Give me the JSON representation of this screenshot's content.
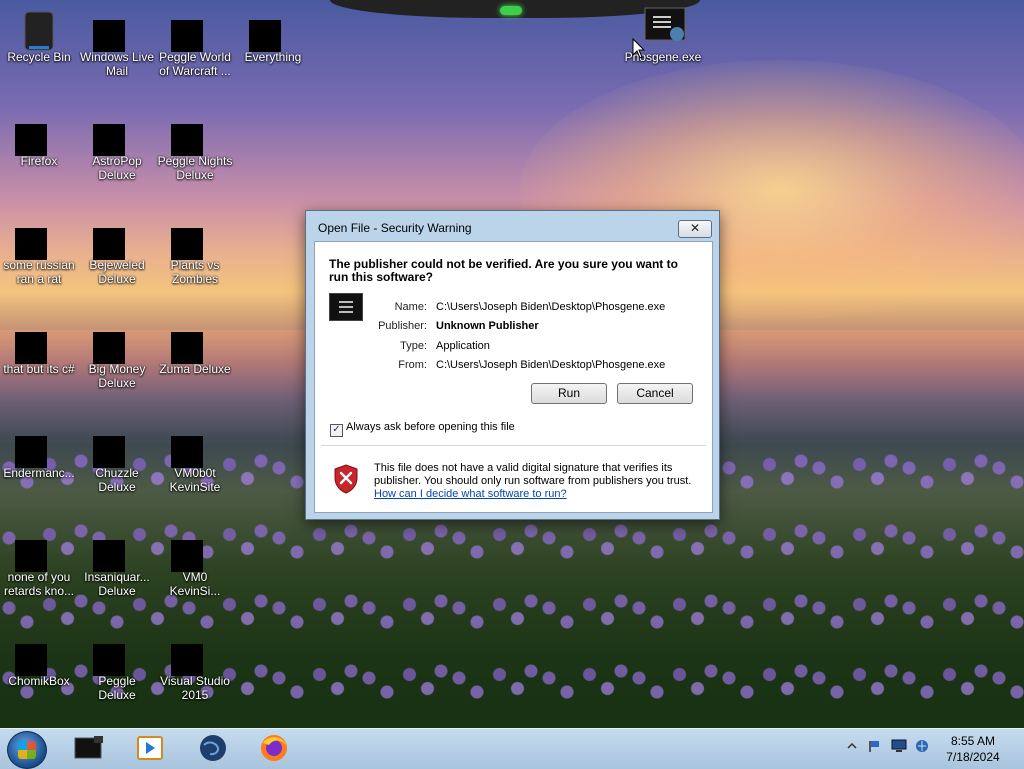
{
  "desktop_icons": [
    {
      "label": "Recycle Bin"
    },
    {
      "label": "Windows Live Mail"
    },
    {
      "label": "Peggle World of Warcraft ..."
    },
    {
      "label": "Everything"
    },
    {
      "label": "Phosgene.exe"
    },
    {
      "label": "Firefox"
    },
    {
      "label": "AstroPop Deluxe"
    },
    {
      "label": "Peggle Nights Deluxe"
    },
    {
      "label": "some russian ran a rat"
    },
    {
      "label": "Bejeweled Deluxe"
    },
    {
      "label": "Plants vs Zombies"
    },
    {
      "label": "that but its c#"
    },
    {
      "label": "Big Money Deluxe"
    },
    {
      "label": "Zuma Deluxe"
    },
    {
      "label": "Endermanc..."
    },
    {
      "label": "Chuzzle Deluxe"
    },
    {
      "label": "VM0b0t KevinSite"
    },
    {
      "label": "none of you retards kno..."
    },
    {
      "label": "Insaniquar... Deluxe"
    },
    {
      "label": "VM0 KevinSi..."
    },
    {
      "label": "ChomikBox"
    },
    {
      "label": "Peggle Deluxe"
    },
    {
      "label": "Visual Studio 2015"
    }
  ],
  "dialog": {
    "title": "Open File - Security Warning",
    "close_label": "✕",
    "heading": "The publisher could not be verified.  Are you sure you want to run this software?",
    "fields": [
      {
        "key": "Name:",
        "value": "C:\\Users\\Joseph Biden\\Desktop\\Phosgene.exe"
      },
      {
        "key": "Publisher:",
        "value": "Unknown Publisher"
      },
      {
        "key": "Type:",
        "value": "Application"
      },
      {
        "key": "From:",
        "value": "C:\\Users\\Joseph Biden\\Desktop\\Phosgene.exe"
      }
    ],
    "run_label": "Run",
    "cancel_label": "Cancel",
    "checkbox_label": "Always ask before opening this file",
    "checkbox_mark": "✓",
    "warning_text": "This file does not have a valid digital signature that verifies its publisher.  You should only run software from publishers you trust.",
    "help_link": "How can I decide what software to run?"
  },
  "taskbar": {
    "clock_time": "8:55 AM",
    "clock_date": "7/18/2024"
  },
  "colors": {
    "taskbar": "#b7cfe6",
    "dialog_frame": "#bcd4ea",
    "link": "#0645ad",
    "shield": "#c8262b"
  }
}
